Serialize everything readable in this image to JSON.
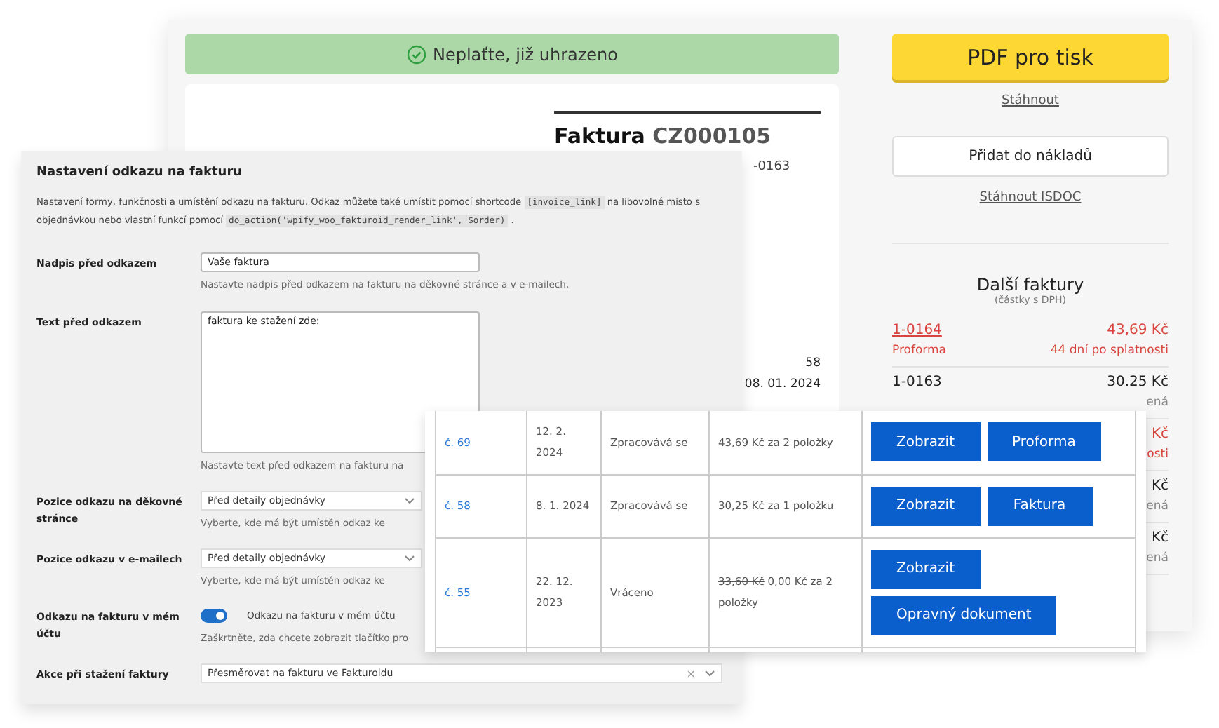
{
  "invoice_page": {
    "paid_banner": "Neplaťte, již uhrazeno",
    "document": {
      "title": "Faktura",
      "number": "CZ000105",
      "ref": "-0163",
      "lines": [
        "58",
        "08. 01. 2024"
      ]
    },
    "pdf_button": "PDF pro tisk",
    "download_link": "Stáhnout",
    "add_button": "Přidat do nákladů",
    "isdoc_link": "Stáhnout ISDOC",
    "other_invoices": {
      "title": "Další faktury",
      "subtitle": "(částky s DPH)",
      "rows": [
        {
          "number": "1-0164",
          "amount": "43,69 Kč",
          "type": "Proforma",
          "note": "44 dní po splatnosti",
          "overdue": true
        },
        {
          "number": "1-0163",
          "amount": "30.25 Kč",
          "note": "ená",
          "overdue": false
        },
        {
          "amount": "Kč",
          "note": "osti",
          "overdue": true
        },
        {
          "amount": "Kč",
          "note": "ená",
          "overdue": false
        },
        {
          "amount": "Kč",
          "note": "ená",
          "overdue": false
        }
      ]
    }
  },
  "settings": {
    "title": "Nastavení odkazu na fakturu",
    "description": [
      {
        "kind": "text",
        "text": "Nastavení formy, funkčnosti a umístění odkazu na fakturu. Odkaz můžete také umístit pomocí shortcode "
      },
      {
        "kind": "code",
        "text": "[invoice_link]"
      },
      {
        "kind": "text",
        "text": " na libovolné místo s objednávkou nebo vlastní funkcí pomocí "
      },
      {
        "kind": "code",
        "text": "do_action('wpify_woo_fakturoid_render_link', $order)"
      },
      {
        "kind": "text",
        "text": " ."
      }
    ],
    "rows": [
      {
        "label": "Nadpis před odkazem",
        "kind": "input",
        "value": "Vaše faktura",
        "hint": "Nastavte nadpis před odkazem na fakturu na děkovné stránce a v e-mailech."
      },
      {
        "label": "Text před odkazem",
        "kind": "textarea",
        "value": "faktura ke stažení zde:",
        "hint": "Nastavte text před odkazem na fakturu na"
      },
      {
        "label": "Pozice odkazu na děkovné stránce",
        "kind": "select",
        "value": "Před detaily objednávky",
        "hint": "Vyberte, kde má být umístěn odkaz ke"
      },
      {
        "label": "Pozice odkazu v e-mailech",
        "kind": "select",
        "value": "Před detaily objednávky",
        "hint": "Vyberte, kde má být umístěn odkaz ke"
      },
      {
        "label": "Odkazu na fakturu v mém účtu",
        "kind": "toggle",
        "on": true,
        "value": "Odkazu na fakturu v mém účtu",
        "hint": "Zaškrtněte, zda chcete zobrazit tlačítko pro"
      },
      {
        "label": "Akce při stažení faktury",
        "kind": "select",
        "value": "Přesměrovat na fakturu ve Fakturoidu",
        "clear": "×"
      }
    ]
  },
  "orders": {
    "rows": [
      {
        "order": "č. 69",
        "date": "12. 2. 2024",
        "status": "Zpracovává se",
        "total": "43,69 Kč za 2 položky",
        "actions": [
          "Zobrazit",
          "Proforma"
        ],
        "stacked": false
      },
      {
        "order": "č. 58",
        "date": "8. 1. 2024",
        "status": "Zpracovává se",
        "total": "30,25 Kč za 1 položku",
        "actions": [
          "Zobrazit",
          "Faktura"
        ],
        "stacked": false
      },
      {
        "order": "č. 55",
        "date": "22. 12. 2023",
        "status": "Vráceno",
        "old_total": "33,60 Kč",
        "total": "0,00 Kč za 2 položky",
        "actions": [
          "Zobrazit",
          "Opravný dokument"
        ],
        "stacked": true
      }
    ]
  }
}
